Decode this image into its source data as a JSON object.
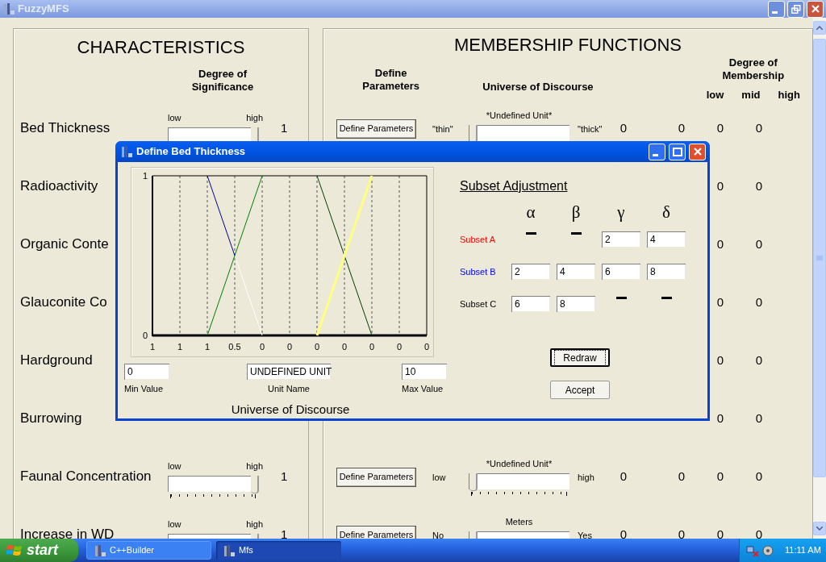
{
  "window": {
    "title": "FuzzyMFS"
  },
  "characteristics": {
    "title": "CHARACTERISTICS",
    "heading": "Degree of Significance"
  },
  "membership": {
    "title": "MEMBERSHIP FUNCTIONS",
    "define_heading": "Define Parameters",
    "universe_heading": "Universe of Discourse",
    "degree_heading": "Degree of Membership",
    "low": "low",
    "mid": "mid",
    "high": "high"
  },
  "rows": [
    {
      "kind": "full",
      "name": "Bed Thickness",
      "significance": {
        "low": "low",
        "high": "high",
        "level": 1,
        "value": "1"
      },
      "button": "Define Parameters",
      "universe": {
        "unit": "*Undefined Unit*",
        "left": "\"thin\"",
        "right": "\"thick\"",
        "level": 0
      },
      "value": "0",
      "low": "0",
      "mid": "0",
      "high": "0"
    },
    {
      "kind": "covered",
      "name": "Radioactivity",
      "mid": "0",
      "high": "0"
    },
    {
      "kind": "covered",
      "name": "Organic Conte",
      "mid": "0",
      "high": "0"
    },
    {
      "kind": "covered",
      "name": "Glauconite Co",
      "mid": "0",
      "high": "0"
    },
    {
      "kind": "covered",
      "name": "Hardground",
      "mid": "0",
      "high": "0"
    },
    {
      "kind": "covered",
      "name": "Burrowing",
      "mid": "0",
      "high": "0"
    },
    {
      "kind": "full",
      "name": "Faunal Concentration",
      "significance": {
        "low": "low",
        "high": "high",
        "level": 1,
        "value": "1"
      },
      "button": "Define Parameters",
      "universe": {
        "unit": "*Undefined Unit*",
        "left": "low",
        "right": "high",
        "level": 0
      },
      "value": "0",
      "low": "0",
      "mid": "0",
      "high": "0"
    },
    {
      "kind": "full",
      "name": "Increase in WD",
      "significance": {
        "low": "low",
        "high": "high",
        "level": 1,
        "value": "1"
      },
      "button": "Define Parameters",
      "universe": {
        "unit": "Meters",
        "left": "No",
        "right": "Yes",
        "level": 0
      },
      "value": "0",
      "low": "0",
      "mid": "0",
      "high": "0"
    }
  ],
  "dialog": {
    "title": "Define Bed Thickness",
    "chart_data": {
      "type": "line",
      "grid": true,
      "categories": [
        "1",
        "1",
        "1",
        "0.5",
        "0",
        "0",
        "0",
        "0",
        "0",
        "0",
        "0"
      ],
      "ylim": [
        0,
        1
      ],
      "yticks": [
        0,
        1
      ],
      "series": [
        {
          "color": "#0000a0",
          "values": [
            null,
            null,
            1,
            0.5,
            null,
            null,
            null,
            null,
            null,
            null,
            null
          ]
        },
        {
          "color": "#ffffff",
          "values": [
            null,
            null,
            null,
            0.5,
            0,
            null,
            null,
            null,
            null,
            null,
            null
          ]
        },
        {
          "color": "#008000",
          "values": [
            null,
            null,
            0,
            0.5,
            1,
            null,
            null,
            null,
            null,
            null,
            null
          ]
        },
        {
          "color": "#004000",
          "values": [
            null,
            null,
            null,
            null,
            null,
            null,
            1,
            0.5,
            0,
            null,
            null
          ]
        },
        {
          "color": "#ffff80",
          "values": [
            null,
            null,
            null,
            null,
            null,
            null,
            0,
            0.5,
            1,
            null,
            null
          ]
        }
      ]
    },
    "min": {
      "value": "0",
      "label": "Min Value"
    },
    "unit": {
      "value": "UNDEFINED UNIT",
      "label": "Unit Name"
    },
    "max": {
      "value": "10",
      "label": "Max Value"
    },
    "caption": "Universe of Discourse",
    "subset_title": "Subset Adjustment",
    "params": [
      "α",
      "β",
      "γ",
      "δ"
    ],
    "subsets": [
      {
        "label": "Subset A",
        "color": "#ff0000",
        "cells": [
          {
            "kind": "dash"
          },
          {
            "kind": "dash"
          },
          {
            "kind": "field",
            "value": "2"
          },
          {
            "kind": "field",
            "value": "4"
          }
        ]
      },
      {
        "label": "Subset B",
        "color": "#0000ff",
        "cells": [
          {
            "kind": "field",
            "value": "2"
          },
          {
            "kind": "field",
            "value": "4"
          },
          {
            "kind": "field",
            "value": "6"
          },
          {
            "kind": "field",
            "value": "8"
          }
        ]
      },
      {
        "label": "Subset C",
        "color": "#000000",
        "cells": [
          {
            "kind": "field",
            "value": "6"
          },
          {
            "kind": "field",
            "value": "8"
          },
          {
            "kind": "dash"
          },
          {
            "kind": "dash"
          }
        ]
      }
    ],
    "buttons": [
      {
        "label": "Redraw",
        "focused": true
      },
      {
        "label": "Accept",
        "focused": false
      }
    ]
  },
  "taskbar": {
    "start": "start",
    "tasks": [
      {
        "label": "C++Builder",
        "selected": false
      },
      {
        "label": "Mfs",
        "selected": true
      }
    ],
    "clock": "11:11 AM"
  }
}
